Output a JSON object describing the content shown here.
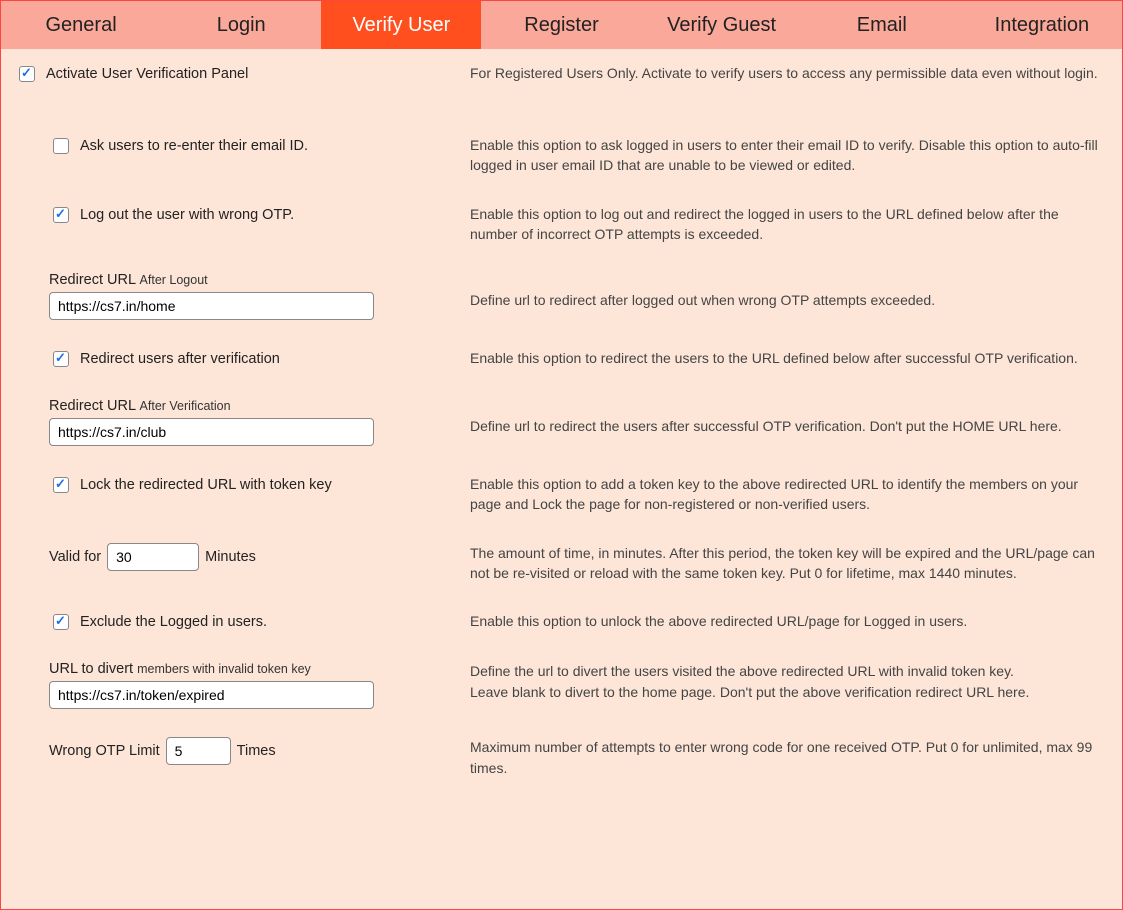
{
  "tabs": [
    {
      "label": "General"
    },
    {
      "label": "Login"
    },
    {
      "label": "Verify User"
    },
    {
      "label": "Register"
    },
    {
      "label": "Verify Guest"
    },
    {
      "label": "Email"
    },
    {
      "label": "Integration"
    }
  ],
  "activate": {
    "label": "Activate User Verification Panel",
    "desc": "For Registered Users Only. Activate to verify users to access any permissible data even without login."
  },
  "reenter": {
    "label": "Ask users to re-enter their email ID.",
    "desc": "Enable this option to ask logged in users to enter their email ID to verify. Disable this option to auto-fill logged in user email ID that are unable to be viewed or edited."
  },
  "logout_wrong": {
    "label": "Log out the user with wrong OTP.",
    "desc": "Enable this option to log out and redirect the logged in users to the URL defined below after the number of incorrect OTP attempts is exceeded."
  },
  "redirect_logout": {
    "label": "Redirect URL",
    "suffix": "After Logout",
    "value": "https://cs7.in/home",
    "desc": "Define url to redirect after logged out when wrong OTP attempts exceeded."
  },
  "redirect_after_verify_check": {
    "label": "Redirect users after verification",
    "desc": "Enable this option to redirect the users to the URL defined below after successful OTP verification."
  },
  "redirect_verify": {
    "label": "Redirect URL",
    "suffix": "After Verification",
    "value": "https://cs7.in/club",
    "desc": "Define url to redirect the users after successful OTP verification. Don't put the HOME URL here."
  },
  "lock_token": {
    "label": "Lock the redirected URL with token key",
    "desc": "Enable this option to add a token key to the above redirected URL to identify the members on your page and Lock the page for non-registered or non-verified users."
  },
  "valid_for": {
    "prefix": "Valid for",
    "value": "30",
    "suffix": "Minutes",
    "desc": "The amount of time, in minutes. After this period, the token key will be expired and the URL/page can not be re-visited or reload with the same token key. Put 0 for lifetime, max 1440 minutes."
  },
  "exclude_logged": {
    "label": "Exclude the Logged in users.",
    "desc": "Enable this option to unlock the above redirected URL/page for Logged in users."
  },
  "divert_url": {
    "label": "URL to divert",
    "suffix": "members with invalid token key",
    "value": "https://cs7.in/token/expired",
    "desc_a": "Define the url to divert the users visited the above redirected URL with invalid token key.",
    "desc_b": "Leave blank to divert to the home page. Don't put the above verification redirect URL here."
  },
  "wrong_limit": {
    "prefix": "Wrong OTP Limit",
    "value": "5",
    "suffix": "Times",
    "desc": "Maximum number of attempts to enter wrong code for one received OTP. Put 0 for unlimited, max 99 times."
  }
}
